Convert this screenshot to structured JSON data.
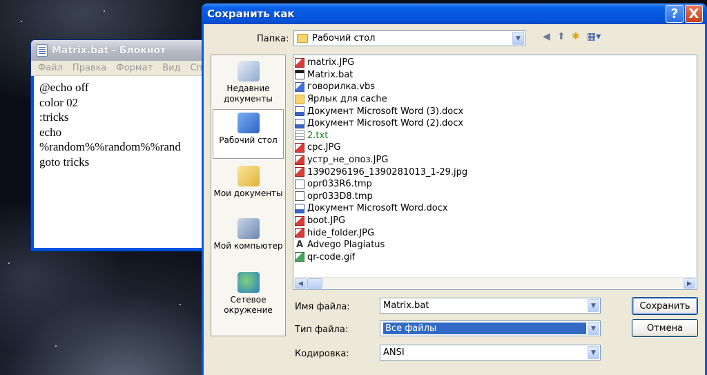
{
  "notepad": {
    "title": "Matrix.bat - Блокнот",
    "menu": [
      "Файл",
      "Правка",
      "Формат",
      "Вид",
      "Спр"
    ],
    "lines": [
      "@echo off",
      "color 02",
      ":tricks",
      "echo",
      "%random%%random%%rand",
      "goto tricks"
    ]
  },
  "dialog": {
    "title": "Сохранить как",
    "help_label": "?",
    "close_label": "X",
    "folder_label": "Папка:",
    "folder_value": "Рабочий стол",
    "places": [
      {
        "label": "Недавние документы",
        "icon": "recent-documents-icon"
      },
      {
        "label": "Рабочий стол",
        "icon": "desktop-icon"
      },
      {
        "label": "Мои документы",
        "icon": "my-documents-icon"
      },
      {
        "label": "Мой компьютер",
        "icon": "my-computer-icon"
      },
      {
        "label": "Сетевое окружение",
        "icon": "network-icon"
      }
    ],
    "files": [
      {
        "name": "matrix.JPG",
        "type": "jpg"
      },
      {
        "name": "Matrix.bat",
        "type": "bat"
      },
      {
        "name": "говорилка.vbs",
        "type": "vbs"
      },
      {
        "name": "Ярлык для cache",
        "type": "lnk"
      },
      {
        "name": "Документ Microsoft Word (3).docx",
        "type": "doc"
      },
      {
        "name": "Документ Microsoft Word (2).docx",
        "type": "doc"
      },
      {
        "name": "2.txt",
        "type": "txt"
      },
      {
        "name": "срс.JPG",
        "type": "jpg"
      },
      {
        "name": "устр_не_опоз.JPG",
        "type": "jpg"
      },
      {
        "name": "1390296196_1390281013_1-29.jpg",
        "type": "jpg"
      },
      {
        "name": "opr033R6.tmp",
        "type": "tmp"
      },
      {
        "name": "opr033D8.tmp",
        "type": "tmp"
      },
      {
        "name": "Документ Microsoft Word.docx",
        "type": "doc"
      },
      {
        "name": "boot.JPG",
        "type": "jpg"
      },
      {
        "name": "hide_folder.JPG",
        "type": "jpg"
      },
      {
        "name": "Advego Plagiatus",
        "type": "app"
      },
      {
        "name": "qr-code.gif",
        "type": "gif"
      }
    ],
    "filename_label": "Имя файла:",
    "filename_value": "Matrix.bat",
    "filetype_label": "Тип файла:",
    "filetype_value": "Все файлы",
    "encoding_label": "Кодировка:",
    "encoding_value": "ANSI",
    "save_label": "Сохранить",
    "cancel_label": "Отмена"
  }
}
